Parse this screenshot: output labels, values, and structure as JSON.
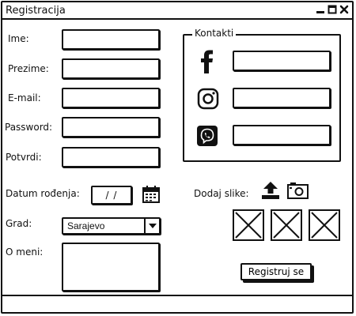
{
  "window": {
    "title": "Registracija"
  },
  "form": {
    "ime_label": "Ime:",
    "prezime_label": "Prezime:",
    "email_label": "E-mail:",
    "password_label": "Password:",
    "potvrdi_label": "Potvrdi:",
    "datum_label": "Datum rođenja:",
    "datum_value": "/ /",
    "grad_label": "Grad:",
    "grad_value": "Sarajevo",
    "o_meni_label": "O meni:"
  },
  "contacts": {
    "legend": "Kontakti",
    "icons": [
      "facebook-icon",
      "instagram-icon",
      "viber-icon"
    ]
  },
  "images": {
    "label": "Dodaj slike:",
    "icons": [
      "upload-icon",
      "camera-icon"
    ],
    "placeholder_count": 3
  },
  "actions": {
    "register_label": "Registruj se"
  },
  "colors": {
    "ink": "#111111",
    "background": "#ffffff"
  }
}
